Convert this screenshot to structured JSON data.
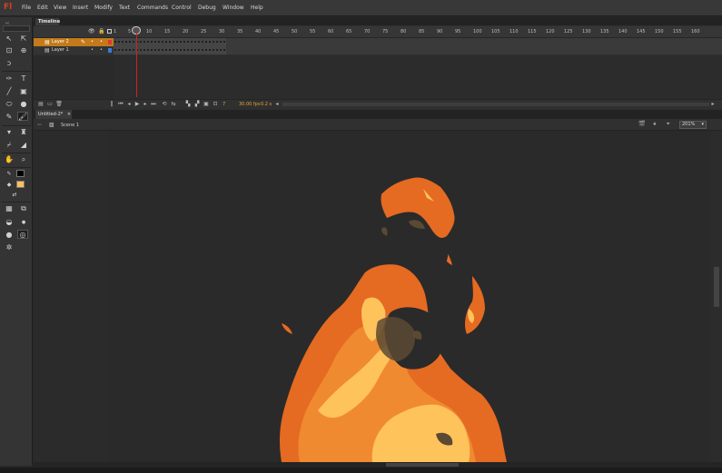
{
  "app": {
    "logo": "Fl"
  },
  "menu": [
    "File",
    "Edit",
    "View",
    "Insert",
    "Modify",
    "Text",
    "Commands",
    "Control",
    "Debug",
    "Window",
    "Help"
  ],
  "timeline": {
    "tab_label": "Timeline",
    "ruler": [
      "1",
      "5",
      "10",
      "15",
      "20",
      "25",
      "30",
      "35",
      "40",
      "45",
      "50",
      "55",
      "60",
      "65",
      "70",
      "75",
      "80",
      "85",
      "90",
      "95",
      "100",
      "105",
      "110",
      "115",
      "120",
      "125",
      "130",
      "135",
      "140",
      "145",
      "150",
      "155",
      "160"
    ],
    "layers": [
      {
        "name": "Layer 2",
        "selected": true
      },
      {
        "name": "Layer 1",
        "selected": false
      }
    ],
    "current_frame": "7",
    "fps": "30.00 fps",
    "elapsed": "0.2 s"
  },
  "document": {
    "tab_label": "Untitled-2*",
    "scene_label": "Scene 1",
    "zoom": "201%"
  },
  "colors": {
    "accent": "#d4421f",
    "stroke_swatch": "#000000",
    "fill_swatch": "#ffbf5e",
    "flame_dark": "#e56a22",
    "flame_mid": "#f08a30",
    "flame_light": "#ffc35c",
    "smoke": "#5a4a33"
  },
  "icons": {
    "tools": [
      "selection-tool-icon",
      "subselection-tool-icon",
      "free-transform-icon",
      "3d-rotation-icon",
      "lasso-icon",
      "pen-icon",
      "text-icon",
      "line-icon",
      "rectangle-primitive-icon",
      "oval-icon",
      "polystar-icon",
      "pencil-icon",
      "brush-icon",
      "paint-bucket-icon",
      "ink-bottle-icon",
      "eyedropper-icon",
      "eraser-icon",
      "hand-icon",
      "zoom-icon"
    ]
  }
}
